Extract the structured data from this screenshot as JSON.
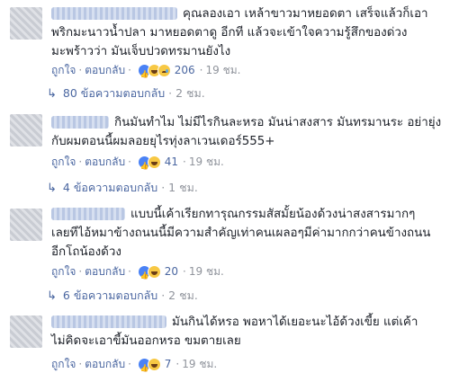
{
  "comments": [
    {
      "text_lines": [
        "คุณลองเอา เหล้าขาวมาหยอดตา เสร็จแล้วก็เอา",
        "พริกมะนาวน้ำปลา มาหยอดตาดู อีกที แล้วจะเข้าใจความรู้สึกของด่วง",
        "มะพร้าวว่า มันเจ็บปวดทรมานยังไง"
      ],
      "like_label": "ถูกใจ",
      "reply_label": "ตอบกลับ",
      "reactions": [
        "like-icon",
        "haha-icon",
        "sad-icon"
      ],
      "reaction_count": "206",
      "time": "19 ชม.",
      "replies_label": "80 ข้อความตอบกลับ",
      "replies_time": "2 ชม."
    },
    {
      "text_lines": [
        "กินมันทำไม ไม่มีไรกินละหรอ มันน่าสงสาร มันทรมานระ อย่ายุ่ง",
        "กับผมตอนนี้ผมลอยยุไรทุ่งลาเวนเดอร์555+"
      ],
      "like_label": "ถูกใจ",
      "reply_label": "ตอบกลับ",
      "reactions": [
        "like-icon",
        "haha-icon"
      ],
      "reaction_count": "41",
      "time": "19 ชม.",
      "replies_label": "4 ข้อความตอบกลับ",
      "replies_time": "1 ชม."
    },
    {
      "text_lines": [
        "แบบนี้เค้าเรียกทารุณกรรมสัสมั้ยน้องด้วงน่าสงสารมากๆ",
        "เลยทีไอ้หมาข้างถนนนี้มีความสำคัญเท่าคนเผลอๆมีค่ามากกว่าคนข้างถนน",
        "อีกโถน้องด้วง"
      ],
      "like_label": "ถูกใจ",
      "reply_label": "ตอบกลับ",
      "reactions": [
        "like-icon",
        "haha-icon"
      ],
      "reaction_count": "20",
      "time": "19 ชม.",
      "replies_label": "6 ข้อความตอบกลับ",
      "replies_time": "2 ชม."
    },
    {
      "text_lines": [
        "มันกินได้หรอ พอหาได้เยอะนะไอ้ด้วงเขี้ย แต่เค้า",
        "ไม่คิดจะเอาขี้มันออกหรอ ขมตายเลย"
      ],
      "like_label": "ถูกใจ",
      "reply_label": "ตอบกลับ",
      "reactions": [
        "like-icon",
        "haha-icon"
      ],
      "reaction_count": "7",
      "time": "19 ชม."
    }
  ],
  "colors": {
    "link": "#4b67a1",
    "meta": "#90949c",
    "text": "#1d2129"
  }
}
